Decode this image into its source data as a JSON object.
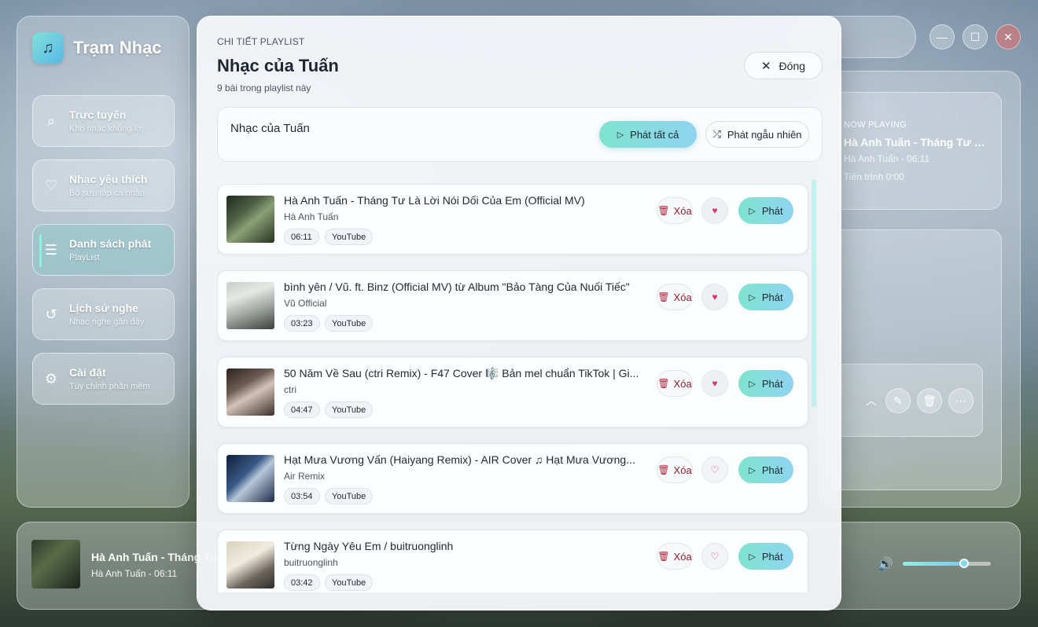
{
  "app": {
    "name": "Trạm Nhạc",
    "logo_glyph": "♫"
  },
  "sidebar": {
    "items": [
      {
        "label": "Trực tuyến",
        "sub": "Kho nhạc khổng lồ",
        "icon": "search-icon",
        "glyph": "⌕"
      },
      {
        "label": "Nhạc yêu thích",
        "sub": "Bộ sưu tập cá nhân",
        "icon": "heart-icon",
        "glyph": "♡"
      },
      {
        "label": "Danh sách phát",
        "sub": "PlayList",
        "icon": "list-icon",
        "glyph": "☰",
        "active": true
      },
      {
        "label": "Lịch sử nghe",
        "sub": "Nhạc nghe gần đây",
        "icon": "history-icon",
        "glyph": "↺"
      },
      {
        "label": "Cài đặt",
        "sub": "Tùy chỉnh phần mềm",
        "icon": "gear-icon",
        "glyph": "⚙"
      }
    ]
  },
  "window_controls": {
    "minimize": "—",
    "maximize": "☐",
    "close": "✕"
  },
  "now_playing": {
    "tag": "NOW PLAYING",
    "title": "Hà Anh Tuấn - Tháng Tư Là Lời Nói Dối Của Em (Official MV)",
    "artist_duration": "Hà Anh Tuấn - 06:11",
    "progress": "Tiến trình 0:00"
  },
  "right_actions": {
    "collapse": "︿",
    "edit": "✎",
    "delete": "🗑",
    "more": "⋯"
  },
  "player": {
    "title": "Hà Anh Tuấn - Tháng Tư Là Lời Nói Dối Của Em",
    "artist_duration": "Hà Anh Tuấn - 06:11",
    "volume_icon": "🔊",
    "volume": 0.7
  },
  "modal": {
    "kicker": "CHI TIẾT PLAYLIST",
    "title": "Nhạc của Tuấn",
    "count": "9 bài trong playlist này",
    "close_label": "Đóng",
    "close_glyph": "✕",
    "header_name": "Nhạc của Tuấn",
    "play_all_label": "Phát tất cả",
    "shuffle_label": "Phát ngẫu nhiên",
    "shuffle_glyph": "⤮",
    "play_glyph": "▷",
    "delete_label": "Xóa",
    "play_label": "Phát",
    "trash_glyph": "🗑",
    "songs": [
      {
        "title": "Hà Anh Tuấn - Tháng Tư Là Lời Nói Dối Của Em (Official MV)",
        "artist": "Hà Anh Tuấn",
        "duration": "06:11",
        "source": "YouTube",
        "favorite": true
      },
      {
        "title": "bình yên / Vũ. ft. Binz (Official MV) từ Album \"Bảo Tàng Của Nuối Tiếc\"",
        "artist": "Vũ Official",
        "duration": "03:23",
        "source": "YouTube",
        "favorite": true
      },
      {
        "title": "50 Năm Về Sau (ctri Remix) - F47 Cover 🎼 Bản mel chuẩn TikTok | Gi...",
        "artist": "ctri",
        "duration": "04:47",
        "source": "YouTube",
        "favorite": true
      },
      {
        "title": "Hạt Mưa Vương Vấn (Haiyang Remix) - AIR Cover ♫ Hạt Mưa Vương...",
        "artist": "Air Remix",
        "duration": "03:54",
        "source": "YouTube",
        "favorite": false
      },
      {
        "title": "Từng Ngày Yêu Em / buitruonglinh",
        "artist": "buitruonglinh",
        "duration": "03:42",
        "source": "YouTube",
        "favorite": false
      }
    ]
  },
  "colors": {
    "accent_start": "#7fe3cf",
    "accent_end": "#8ed4f0",
    "heart": "#d9346a",
    "delete_text": "#8e1f33"
  }
}
